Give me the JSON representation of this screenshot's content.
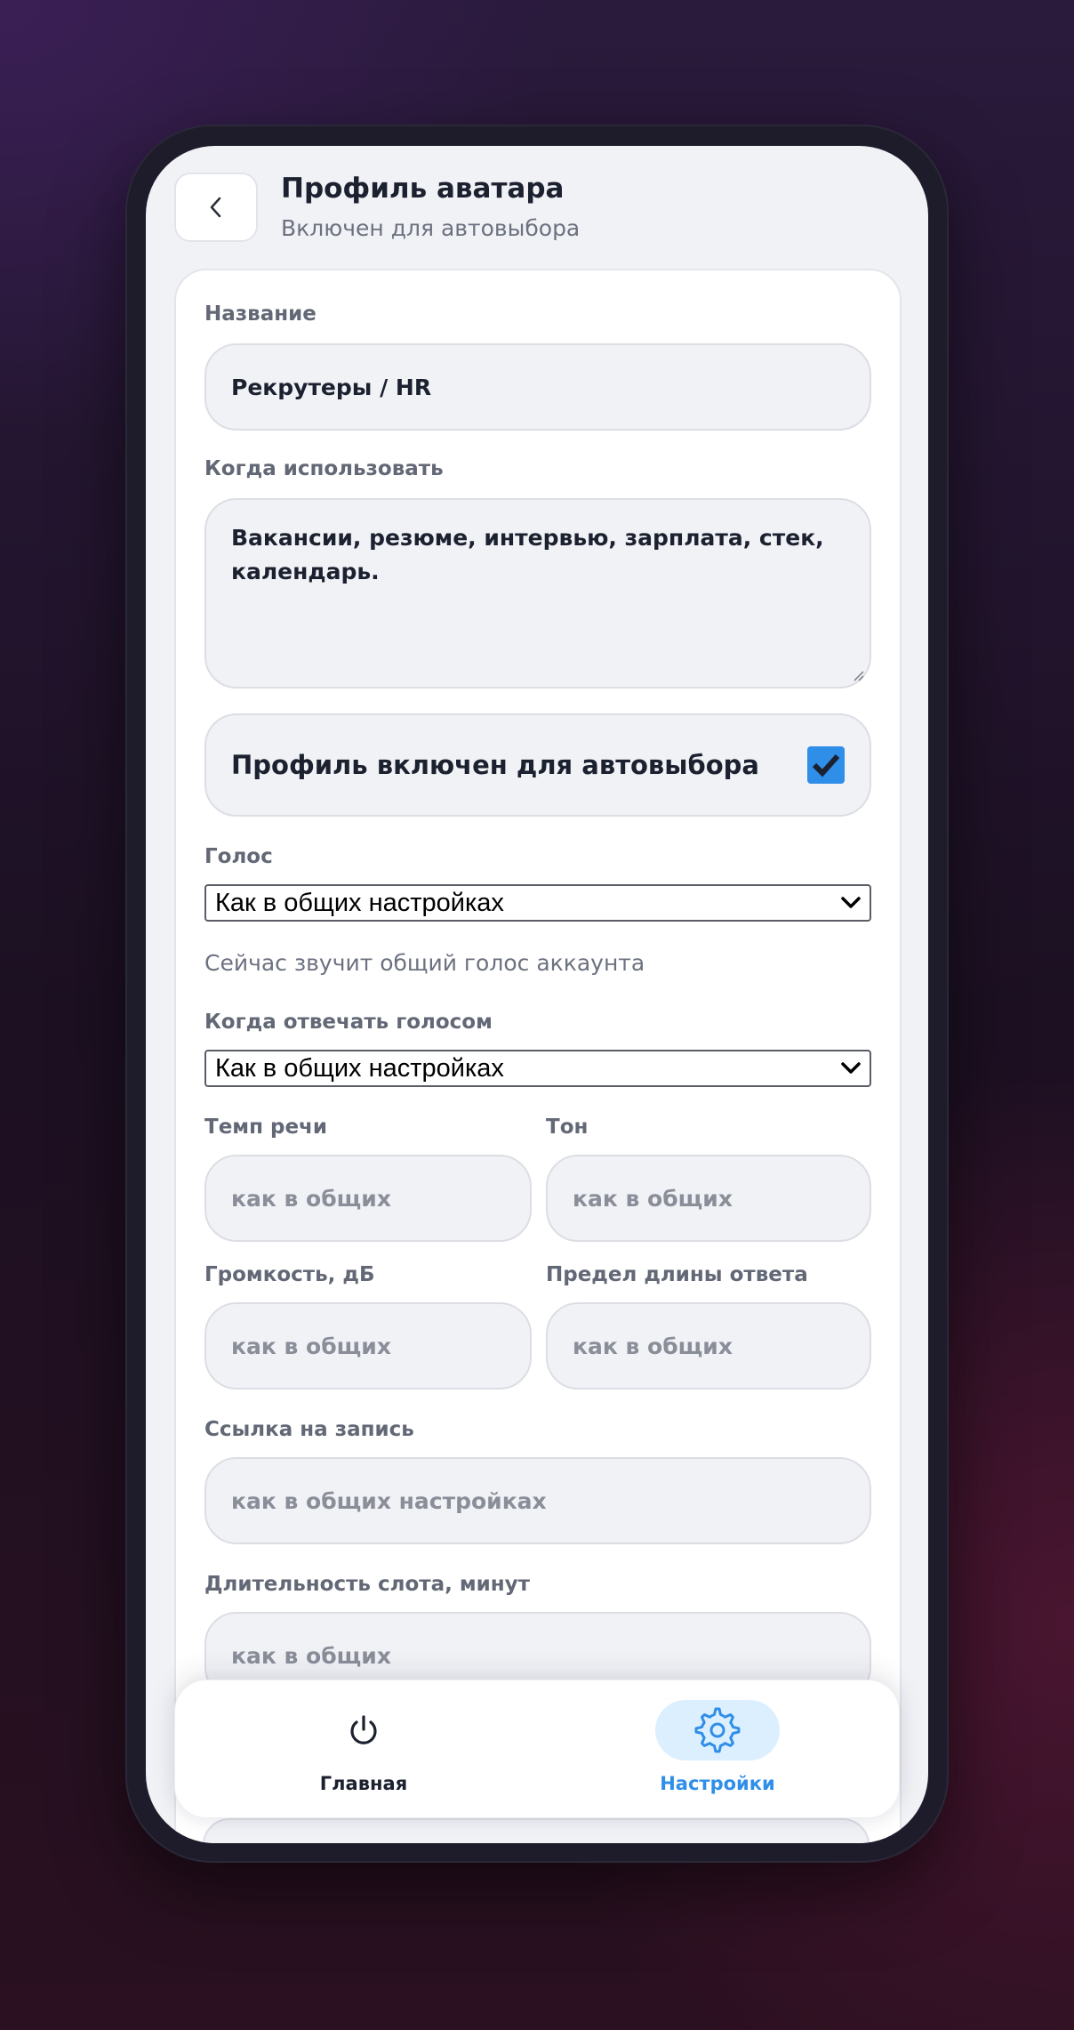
{
  "header": {
    "title": "Профиль аватара",
    "subtitle": "Включен для автовыбора"
  },
  "form": {
    "name": {
      "label": "Название",
      "value": "Рекрутеры / HR"
    },
    "when_to_use": {
      "label": "Когда использовать",
      "value": "Вакансии, резюме, интервью, зарплата, стек, календарь."
    },
    "autoselect": {
      "label": "Профиль включен для автовыбора",
      "checked": true
    },
    "voice": {
      "label": "Голос",
      "selected": "Как в общих настройках",
      "hint": "Сейчас звучит общий голос аккаунта"
    },
    "voice_reply_when": {
      "label": "Когда отвечать голосом",
      "selected": "Как в общих настройках"
    },
    "speech_rate": {
      "label": "Темп речи",
      "placeholder": "как в общих"
    },
    "tone": {
      "label": "Тон",
      "placeholder": "как в общих"
    },
    "volume": {
      "label": "Громкость, дБ",
      "placeholder": "как в общих"
    },
    "reply_length_limit": {
      "label": "Предел длины ответа",
      "placeholder": "как в общих"
    },
    "record_link": {
      "label": "Ссылка на запись",
      "placeholder": "как в общих настройках"
    },
    "slot_duration": {
      "label": "Длительность слота, минут",
      "placeholder": "как в общих"
    }
  },
  "nav": {
    "items": [
      {
        "label": "Главная",
        "icon": "power-icon",
        "active": false
      },
      {
        "label": "Настройки",
        "icon": "gear-icon",
        "active": true
      }
    ]
  },
  "colors": {
    "accent": "#2f8ee8",
    "nav_active_bg": "#dcefff",
    "text_primary": "#1c2130"
  }
}
